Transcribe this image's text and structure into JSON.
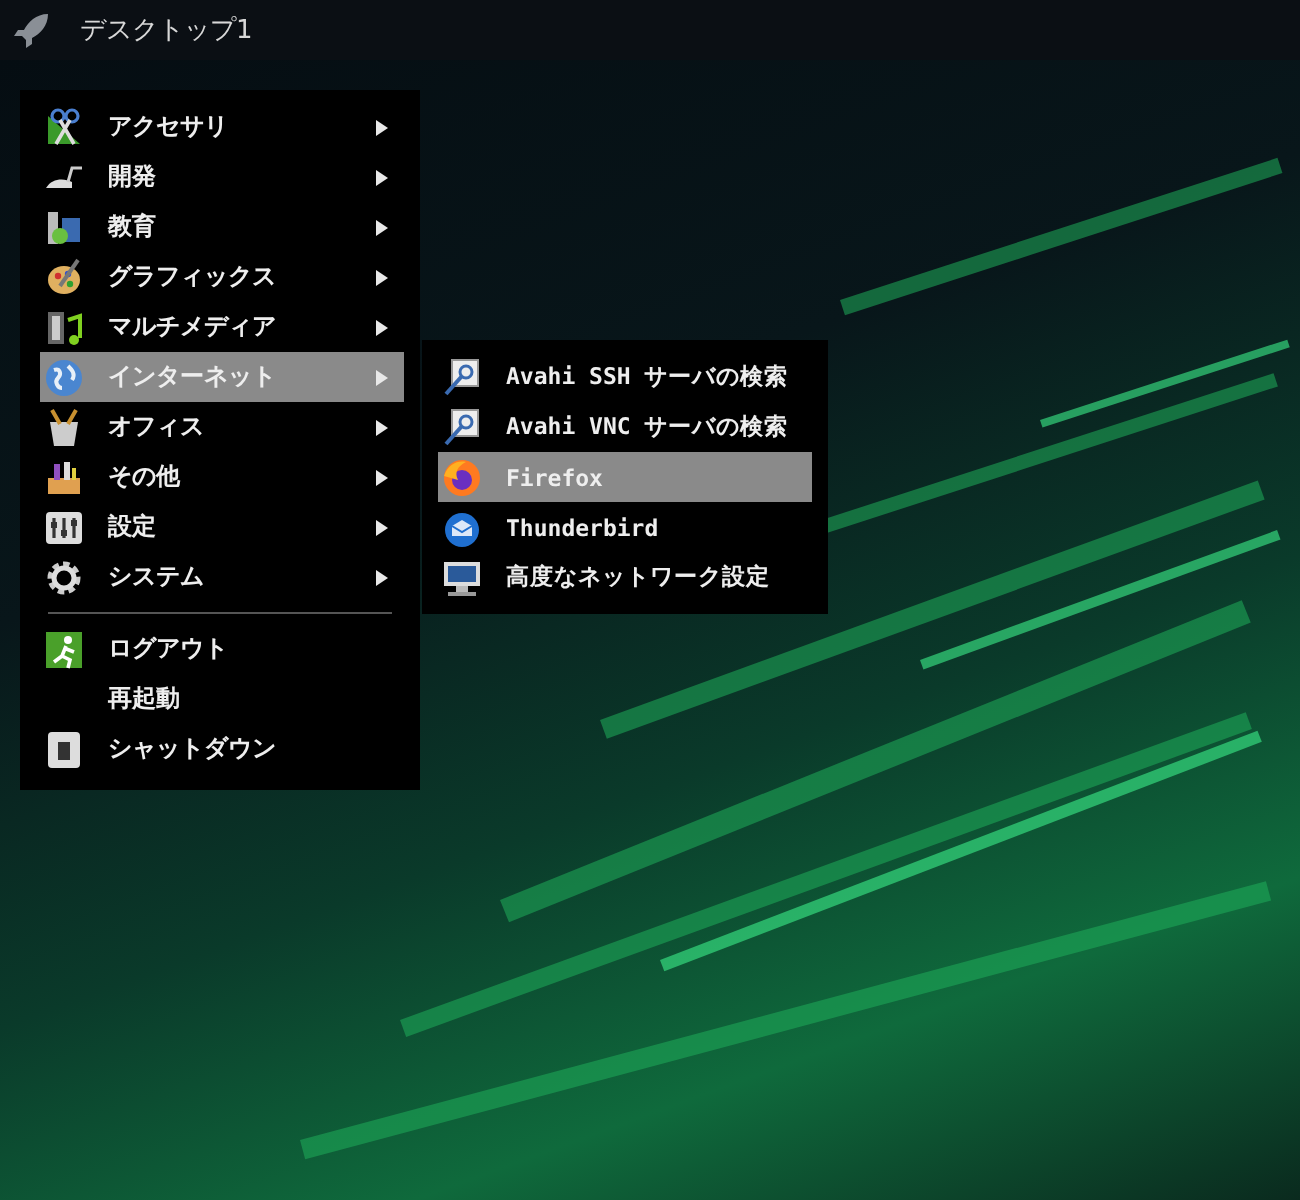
{
  "panel": {
    "title": "デスクトップ1"
  },
  "menu": {
    "items": [
      {
        "kind": "submenu",
        "label": "アクセサリ",
        "selected": false
      },
      {
        "kind": "submenu",
        "label": "開発",
        "selected": false
      },
      {
        "kind": "submenu",
        "label": "教育",
        "selected": false
      },
      {
        "kind": "submenu",
        "label": "グラフィックス",
        "selected": false
      },
      {
        "kind": "submenu",
        "label": "マルチメディア",
        "selected": false
      },
      {
        "kind": "submenu",
        "label": "インターネット",
        "selected": true
      },
      {
        "kind": "submenu",
        "label": "オフィス",
        "selected": false
      },
      {
        "kind": "submenu",
        "label": "その他",
        "selected": false
      },
      {
        "kind": "submenu",
        "label": "設定",
        "selected": false
      },
      {
        "kind": "submenu",
        "label": "システム",
        "selected": false
      },
      {
        "kind": "separator"
      },
      {
        "kind": "action",
        "label": "ログアウト",
        "selected": false
      },
      {
        "kind": "action",
        "label": "再起動",
        "selected": false
      },
      {
        "kind": "action",
        "label": "シャットダウン",
        "selected": false
      }
    ]
  },
  "submenu": {
    "items": [
      {
        "label": "Avahi SSH サーバの検索",
        "selected": false
      },
      {
        "label": "Avahi VNC サーバの検索",
        "selected": false
      },
      {
        "label": "Firefox",
        "selected": true
      },
      {
        "label": "Thunderbird",
        "selected": false
      },
      {
        "label": "高度なネットワーク設定",
        "selected": false
      }
    ]
  }
}
